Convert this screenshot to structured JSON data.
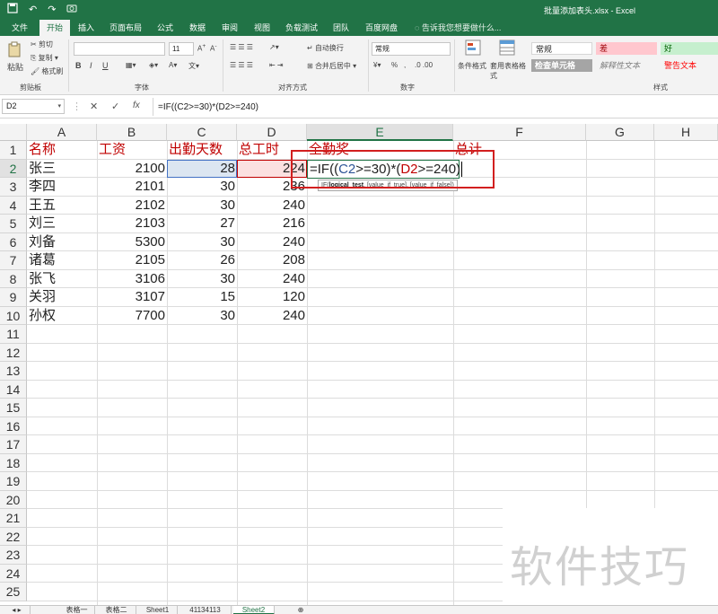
{
  "window": {
    "title": "批量添加表头.xlsx - Excel"
  },
  "qat": {
    "save_icon": "save-icon",
    "undo": "↶",
    "redo": "↷",
    "camera_icon": "camera-icon"
  },
  "tabs": [
    {
      "label": "文件"
    },
    {
      "label": "开始"
    },
    {
      "label": "插入"
    },
    {
      "label": "页面布局"
    },
    {
      "label": "公式"
    },
    {
      "label": "数据"
    },
    {
      "label": "审阅"
    },
    {
      "label": "视图"
    },
    {
      "label": "负载测试"
    },
    {
      "label": "团队"
    },
    {
      "label": "百度网盘"
    }
  ],
  "tell_me": "告诉我您想要做什么...",
  "ribbon": {
    "clipboard": {
      "paste": "粘贴",
      "cut": "剪切",
      "copy": "复制",
      "format_painter": "格式刷",
      "label": "剪贴板"
    },
    "font": {
      "label": "字体",
      "size": "11",
      "bold": "B",
      "italic": "I",
      "underline": "U"
    },
    "alignment": {
      "label": "对齐方式",
      "wrap": "自动换行",
      "merge": "合并后居中"
    },
    "number": {
      "label": "数字",
      "format": "常规",
      "pct": "%"
    },
    "styles": {
      "conditional": "条件格式",
      "table": "套用表格格式",
      "label": "样式",
      "cells": [
        {
          "text": "常规"
        },
        {
          "text": "差"
        },
        {
          "text": "好"
        },
        {
          "text": "检查单元格"
        },
        {
          "text": "解释性文本"
        },
        {
          "text": "警告文本"
        }
      ]
    }
  },
  "formula_bar": {
    "name_box": "D2",
    "cancel": "✕",
    "enter": "✓",
    "fx": "fx",
    "formula": "=IF((C2>=30)*(D2>=240)"
  },
  "columns": [
    "A",
    "B",
    "C",
    "D",
    "E",
    "F",
    "G",
    "H"
  ],
  "rows": [
    "1",
    "2",
    "3",
    "4",
    "5",
    "6",
    "7",
    "8",
    "9",
    "10",
    "11",
    "12",
    "13",
    "14",
    "15",
    "16",
    "17",
    "18",
    "19",
    "20",
    "21",
    "22",
    "23",
    "24",
    "25"
  ],
  "headers": {
    "name": "名称",
    "salary": "工资",
    "days": "出勤天数",
    "hours": "总工时",
    "bonus": "全勤奖",
    "total": "总计"
  },
  "data": [
    {
      "name": "张三",
      "salary": "2100",
      "days": "28",
      "hours": "224"
    },
    {
      "name": "李四",
      "salary": "2101",
      "days": "30",
      "hours": "236"
    },
    {
      "name": "王五",
      "salary": "2102",
      "days": "30",
      "hours": "240"
    },
    {
      "name": "刘三",
      "salary": "2103",
      "days": "27",
      "hours": "216"
    },
    {
      "name": "刘备",
      "salary": "5300",
      "days": "30",
      "hours": "240"
    },
    {
      "name": "诸葛",
      "salary": "2105",
      "days": "26",
      "hours": "208"
    },
    {
      "name": "张飞",
      "salary": "3106",
      "days": "30",
      "hours": "240"
    },
    {
      "name": "关羽",
      "salary": "3107",
      "days": "15",
      "hours": "120"
    },
    {
      "name": "孙权",
      "salary": "7700",
      "days": "30",
      "hours": "240"
    }
  ],
  "edit": {
    "p1": "=IF((",
    "c2": "C2",
    "p2": ">=30)*(",
    "d2": "D2",
    "p3": ">=240)",
    "tooltip_fn": "IF(",
    "tooltip_arg": "logical_test",
    "tooltip_rest": ", [value_if_true], [value_if_false])"
  },
  "sheets": [
    {
      "label": "表格一"
    },
    {
      "label": "表格二"
    },
    {
      "label": "Sheet1"
    },
    {
      "label": "41134113"
    },
    {
      "label": "Sheet2"
    }
  ],
  "watermark": "软件技巧",
  "colors": {
    "excel_green": "#217346",
    "header_red": "#c00000",
    "ref_blue": "#2f5597"
  }
}
